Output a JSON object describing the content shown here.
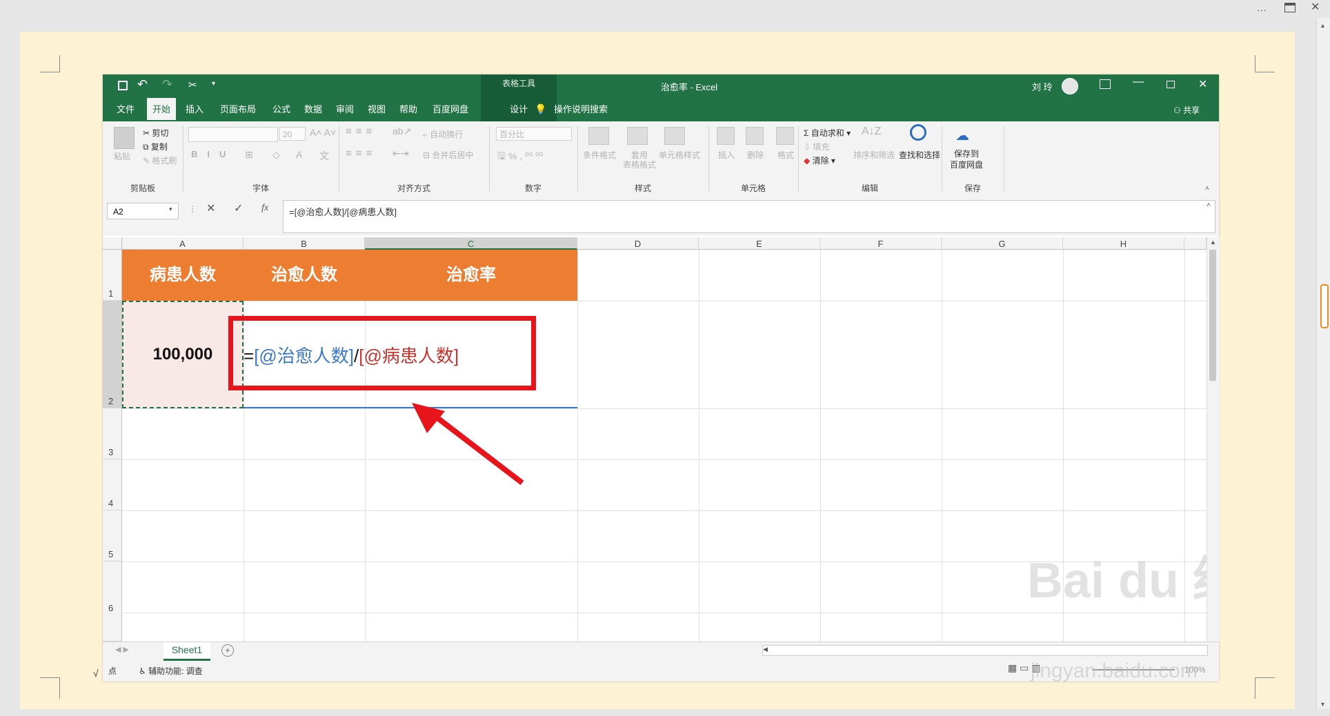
{
  "outer": {
    "more_icon": "ellipsis-icon",
    "layout_icon": "layout-icon",
    "close_icon": "close-icon"
  },
  "excel": {
    "title": "治愈率 - Excel",
    "context_tools": "表格工具",
    "user_name": "刘 玲",
    "share_label": "共享",
    "tell_me": "操作说明搜索",
    "tabs": [
      "文件",
      "开始",
      "插入",
      "页面布局",
      "公式",
      "数据",
      "审阅",
      "视图",
      "帮助",
      "百度网盘",
      "设计"
    ],
    "ribbon": {
      "clipboard": {
        "paste": "粘贴",
        "cut": "剪切",
        "copy": "复制",
        "format_painter": "格式刷",
        "label": "剪贴板"
      },
      "font": {
        "size": "20",
        "label": "字体"
      },
      "alignment": {
        "wrap": "自动换行",
        "merge": "合并后居中",
        "label": "对齐方式"
      },
      "number": {
        "format": "百分比",
        "label": "数字"
      },
      "styles": {
        "conditional": "条件格式",
        "table_format_1": "套用",
        "table_format_2": "表格格式",
        "cell_styles": "单元格样式",
        "label": "样式"
      },
      "cells": {
        "insert": "插入",
        "delete": "删除",
        "format": "格式",
        "label": "单元格"
      },
      "editing": {
        "autosum": "自动求和",
        "fill": "填充",
        "clear": "清除",
        "sort": "排序和筛选",
        "find": "查找和选择",
        "label": "编辑"
      },
      "save": {
        "line1": "保存到",
        "line2": "百度网盘",
        "label": "保存"
      }
    },
    "formula_bar": {
      "name_box": "A2",
      "fx": "fx",
      "formula": "=[@治愈人数]/[@病患人数]"
    },
    "columns": [
      "A",
      "B",
      "C",
      "D",
      "E",
      "F",
      "G",
      "H"
    ],
    "rows": [
      "1",
      "2",
      "3",
      "4",
      "5",
      "6"
    ],
    "table": {
      "headers": [
        "病患人数",
        "治愈人数",
        "治愈率"
      ],
      "a2_value": "100,000",
      "formula_parts": {
        "eq": "=",
        "ref1": "[@治愈人数]",
        "slash": "/",
        "ref2": "[@病患人数]"
      }
    },
    "sheet_tab": "Sheet1",
    "status": {
      "mode": "点",
      "accessibility": "辅助功能: 调查",
      "zoom": "100%"
    }
  },
  "colors": {
    "excel_green": "#217346",
    "header_orange": "#ed7d31",
    "highlight_red": "#e8141c",
    "ref_blue": "#3a78c8",
    "ref_red": "#c7332e"
  },
  "watermark": {
    "brand": "Bai du 经验",
    "url": "jingyan.baidu.com"
  }
}
